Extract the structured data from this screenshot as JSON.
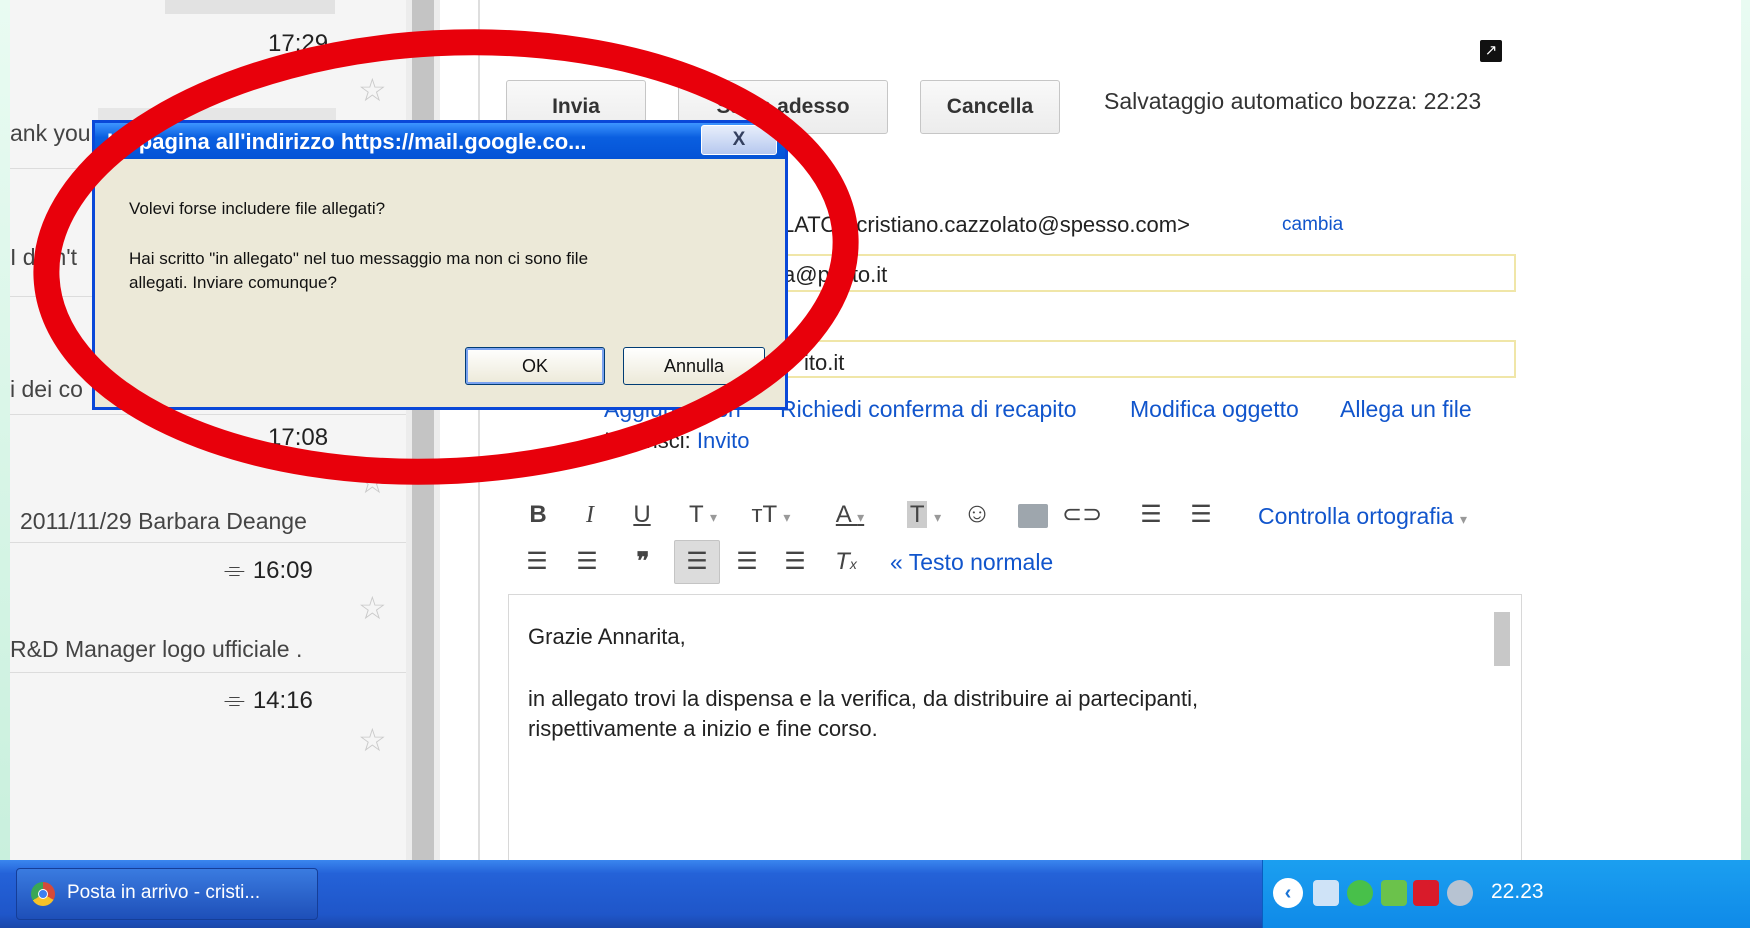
{
  "message_list": {
    "snippets": [
      "ank you",
      "I didn't",
      "i dei co",
      "2011/11/29 Barbara Deange",
      "R&D Manager logo ufficiale ."
    ],
    "times": [
      "17:29",
      "17:08",
      "16:09",
      "14:16"
    ],
    "attachment_icon": "paperclip-icon",
    "star_icon": "star-icon"
  },
  "compose": {
    "buttons": {
      "send": "Invia",
      "save": "Salva adesso",
      "discard": "Cancella"
    },
    "autosave": "Salvataggio automatico bozza: 22:23",
    "from": "LATO <cristiano.cazzolato@spesso.com>",
    "change": "cambia",
    "to_value": "ca@polito.it",
    "cc_value": "ito.it",
    "links": {
      "add_cc": "Aggiungi Ccn",
      "read_receipt": "Richiedi conferma di recapito",
      "edit_subject": "Modifica oggetto",
      "attach": "Allega un file"
    },
    "insert_label": "Inserisci:",
    "insert_link": "Invito",
    "spellcheck": "Controlla ortografia",
    "plain_text": "« Testo normale",
    "body": [
      "Grazie Annarita,",
      "in allegato trovi la dispensa e la verifica, da distribuire ai partecipanti,",
      "rispettivamente a inizio e fine corso."
    ]
  },
  "dialog": {
    "title": "La pagina all'indirizzo https://mail.google.co...",
    "close": "X",
    "question": "Volevi forse includere file allegati?",
    "message_line1": "Hai scritto \"in allegato\" nel tuo messaggio ma non ci sono file",
    "message_line2": "allegati. Inviare comunque?",
    "ok": "OK",
    "cancel": "Annulla"
  },
  "annotation": {
    "color": "#e8000b"
  },
  "taskbar": {
    "window_button": "Posta in arrivo - cristi...",
    "clock": "22.23"
  }
}
